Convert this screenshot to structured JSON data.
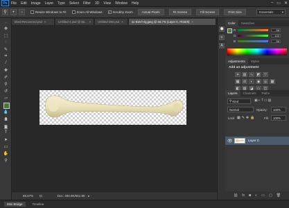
{
  "app": {
    "logo": "Ps",
    "menu": [
      "File",
      "Edit",
      "Image",
      "Layer",
      "Type",
      "Select",
      "Filter",
      "3D",
      "View",
      "Window",
      "Help"
    ],
    "window_controls": [
      "–",
      "▭",
      "✕"
    ]
  },
  "options": {
    "icons": [
      "magnifier-icon",
      "zoom-in-icon",
      "zoom-out-icon"
    ],
    "checks": [
      {
        "label": "Resize Windows to Fit",
        "checked": false
      },
      {
        "label": "Zoom All Windows",
        "checked": false
      },
      {
        "label": "Scrubby Zoom",
        "checked": true
      }
    ],
    "buttons": [
      "Actual Pixels",
      "Fit Screen",
      "Fill Screen",
      "Print Size"
    ],
    "workspace": "Essentials"
  },
  "tabs": [
    {
      "label": "bbed-Recovered.psd",
      "active": false
    },
    {
      "label": "Untitled-4.psd @ 66...",
      "active": false
    },
    {
      "label": "Untitled-390.psd",
      "active": false
    },
    {
      "label": "sc-916-h-lg.jpeg @ 66.7% (Layer 0, RGB/8)",
      "active": true
    }
  ],
  "status": {
    "zoom": "66.67%",
    "doc": "Doc: 480.9K/651.9K"
  },
  "bottom_tabs": [
    "Mini Bridge",
    "Timeline"
  ],
  "color_panel": {
    "tabs": [
      "Color",
      "Swatches"
    ],
    "sliders": [
      {
        "label": "R",
        "value": "68"
      },
      {
        "label": "G",
        "value": "122"
      },
      {
        "label": "B",
        "value": "55"
      }
    ]
  },
  "adjustments": {
    "tabs": [
      "Adjustments",
      "Styles"
    ],
    "title": "Add an adjustment"
  },
  "layers_panel": {
    "tabs": [
      "Layers",
      "Channels",
      "Paths"
    ],
    "kind": "Kind",
    "blend_mode": "Normal",
    "opacity_label": "Opacity:",
    "opacity": "100%",
    "lock_label": "Lock:",
    "fill_label": "Fill:",
    "fill": "100%",
    "layer_name": "Layer 0"
  },
  "colors": {
    "foreground": "#447a37",
    "background": "#ffffff",
    "accent_ps": "#2d8ad6"
  }
}
